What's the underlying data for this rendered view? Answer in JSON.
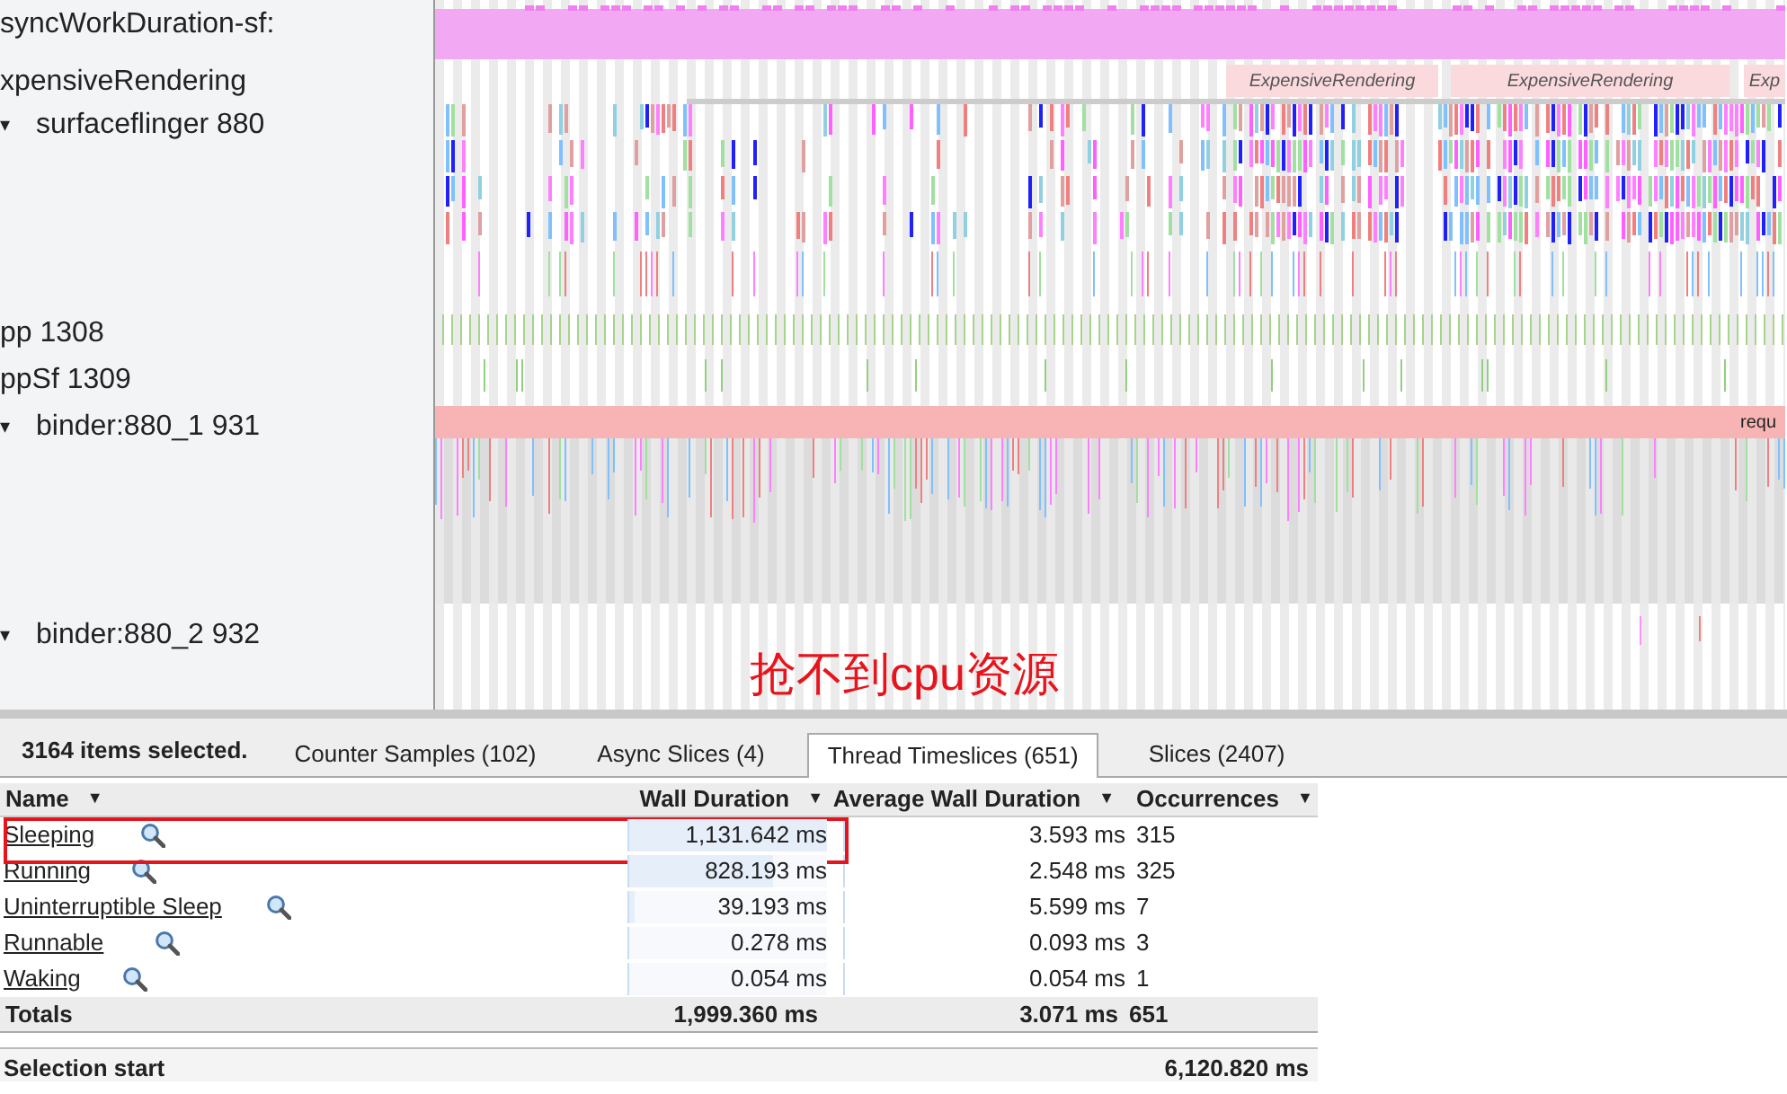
{
  "tracks": [
    {
      "label": "syncWorkDuration-sf:",
      "expandable": false
    },
    {
      "label": "xpensiveRendering",
      "expandable": false
    },
    {
      "label": "surfaceflinger 880",
      "expandable": true,
      "expander": "▾"
    },
    {
      "label": "pp 1308",
      "expandable": false
    },
    {
      "label": "ppSf 1309",
      "expandable": false
    },
    {
      "label": "binder:880_1 931",
      "expandable": true,
      "expander": "▾"
    },
    {
      "label": "binder:880_2 932",
      "expandable": true,
      "expander": "▾"
    }
  ],
  "timeline": {
    "slice_labels": [
      "ExpensiveRendering",
      "ExpensiveRendering",
      "Exp",
      "requ"
    ]
  },
  "annotation": "抢不到cpu资源",
  "selection_summary": "3164 items selected.",
  "tabs": [
    {
      "label": "Counter Samples (102)",
      "selected": false
    },
    {
      "label": "Async Slices (4)",
      "selected": false
    },
    {
      "label": "Thread Timeslices (651)",
      "selected": true
    },
    {
      "label": "Slices (2407)",
      "selected": false
    }
  ],
  "table": {
    "columns": [
      {
        "label": "Name",
        "sort": "▼"
      },
      {
        "label": "Wall Duration",
        "sort": "▼"
      },
      {
        "label": "Average Wall Duration",
        "sort": "▼"
      },
      {
        "label": "Occurrences",
        "sort": "▼"
      }
    ],
    "rows": [
      {
        "name": "Sleeping",
        "wall": "1,131.642 ms",
        "level": 1.0,
        "avg": "3.593 ms",
        "occ": "315",
        "highlighted": true
      },
      {
        "name": "Running",
        "wall": "828.193 ms",
        "level": 0.73,
        "avg": "2.548 ms",
        "occ": "325",
        "highlighted": false
      },
      {
        "name": "Uninterruptible Sleep",
        "wall": "39.193 ms",
        "level": 0.035,
        "avg": "5.599 ms",
        "occ": "7",
        "highlighted": false
      },
      {
        "name": "Runnable",
        "wall": "0.278 ms",
        "level": 0.002,
        "avg": "0.093 ms",
        "occ": "3",
        "highlighted": false
      },
      {
        "name": "Waking",
        "wall": "0.054 ms",
        "level": 0.001,
        "avg": "0.054 ms",
        "occ": "1",
        "highlighted": false
      }
    ],
    "totals": {
      "label": "Totals",
      "wall": "1,999.360 ms",
      "avg": "3.071 ms",
      "occ": "651"
    }
  },
  "selection_start": {
    "label": "Selection start",
    "value": "6,120.820 ms"
  }
}
